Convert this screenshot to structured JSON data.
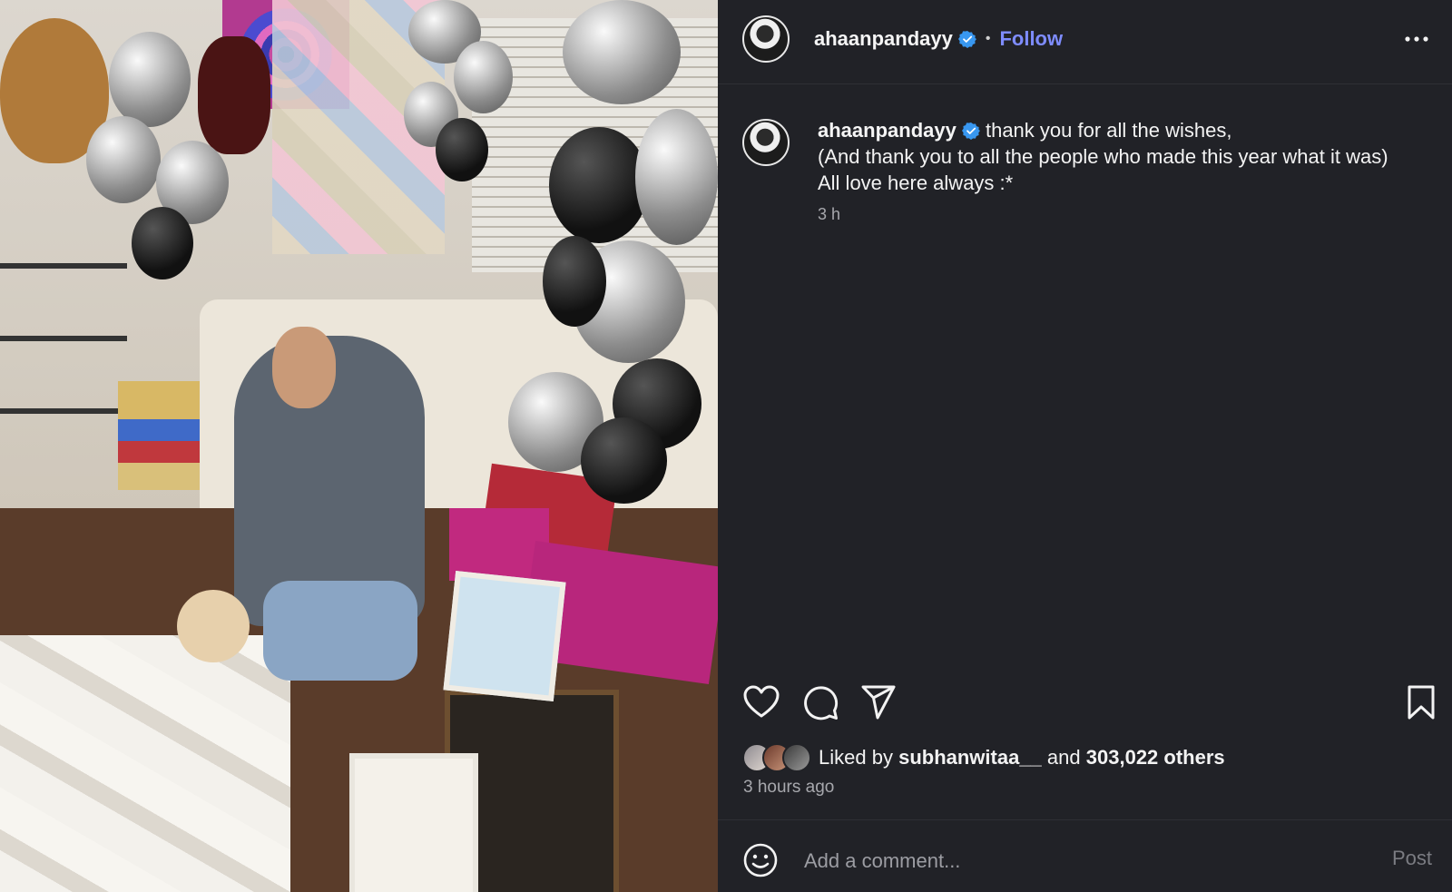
{
  "author": {
    "username": "ahaanpandayy",
    "verified": true,
    "follow_label": "Follow",
    "separator": "•"
  },
  "caption": {
    "username": "ahaanpandayy",
    "lines": [
      "thank you for all the wishes,",
      "(And thank you to all the people who made this year what it was)",
      "All love here always :*"
    ],
    "time": "3 h"
  },
  "actions": {
    "like_icon": "heart-icon",
    "comment_icon": "comment-icon",
    "share_icon": "send-icon",
    "save_icon": "bookmark-icon"
  },
  "likes": {
    "prefix": "Liked by",
    "first_liker": "subhanwitaa__",
    "conjunction": "and",
    "others": "303,022 others"
  },
  "post_time": "3 hours ago",
  "comment": {
    "placeholder": "Add a comment...",
    "post_label": "Post",
    "emoji_icon": "smiley-icon"
  },
  "colors": {
    "panel_bg": "#212227",
    "accent": "#7e8cff",
    "verified": "#3897f0",
    "muted": "#a7a8ad"
  }
}
